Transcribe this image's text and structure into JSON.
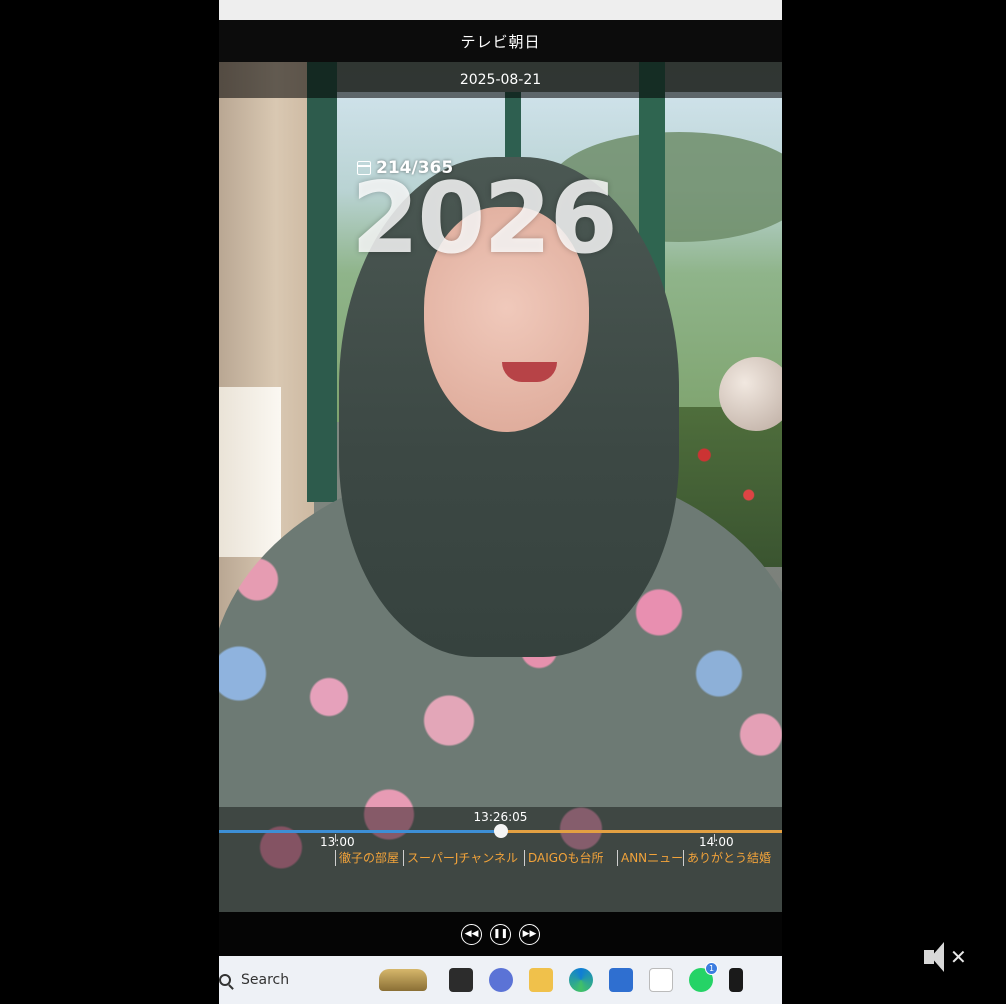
{
  "channel": {
    "name": "テレビ朝日"
  },
  "video": {
    "date": "2025-08-21",
    "day_counter": "214/365",
    "year_overlay": "2026"
  },
  "timeline": {
    "current_time": "13:26:05",
    "progress_fraction": 0.5,
    "ticks": [
      {
        "label": "13:00"
      },
      {
        "label": "14:00"
      }
    ],
    "programs": [
      {
        "title": "徹子の部屋"
      },
      {
        "title": "スーパーJチャンネル"
      },
      {
        "title": "DAIGOも台所"
      },
      {
        "title": "ANNニュース"
      },
      {
        "title": "ありがとう結婚"
      }
    ]
  },
  "controls": {
    "rewind_icon": "rewind-icon",
    "pause_icon": "pause-icon",
    "forward_icon": "fast-forward-icon"
  },
  "taskbar": {
    "search_label": "Search",
    "whatsapp_badge": "1"
  },
  "player": {
    "mute_icon": "speaker-muted-icon"
  }
}
